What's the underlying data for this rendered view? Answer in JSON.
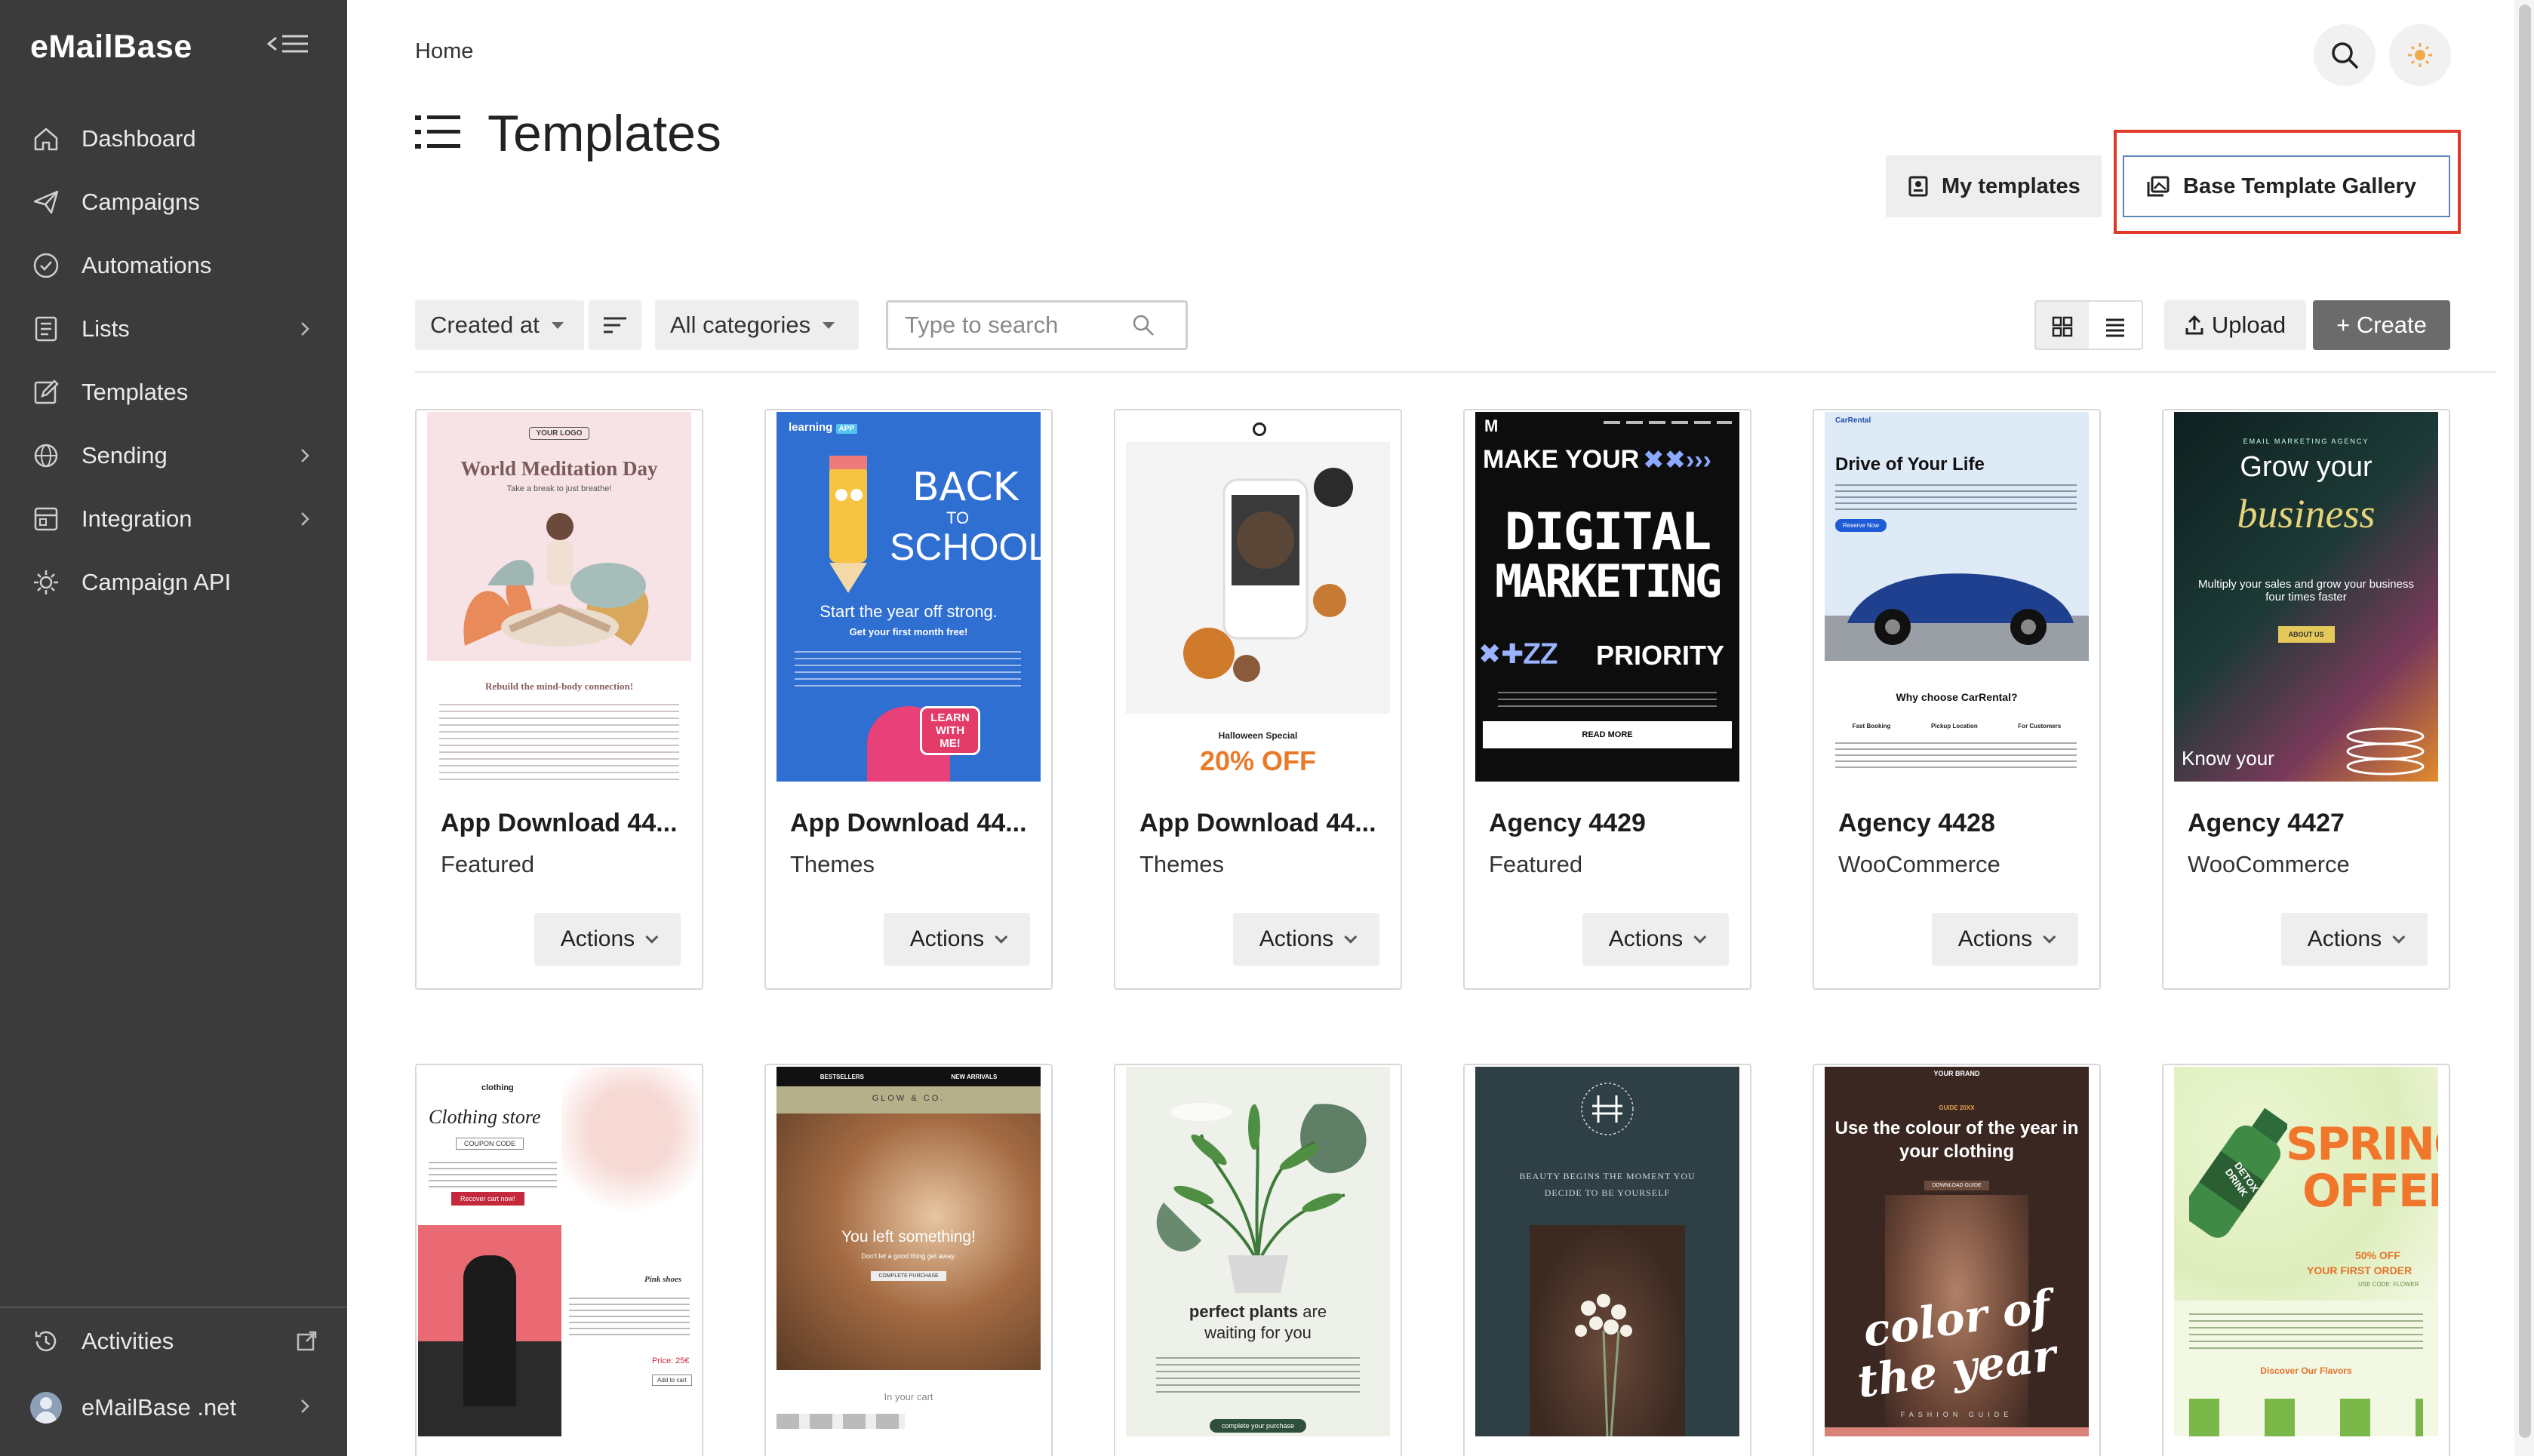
{
  "app": {
    "brand": "eMailBase"
  },
  "sidebar": {
    "items": [
      {
        "label": "Dashboard",
        "icon": "home-icon"
      },
      {
        "label": "Campaigns",
        "icon": "paper-plane-icon"
      },
      {
        "label": "Automations",
        "icon": "shield-check-icon"
      },
      {
        "label": "Lists",
        "icon": "list-icon"
      },
      {
        "label": "Templates",
        "icon": "edit-icon"
      },
      {
        "label": "Sending",
        "icon": "globe-icon"
      },
      {
        "label": "Integration",
        "icon": "integration-icon"
      },
      {
        "label": "Campaign API",
        "icon": "api-gear-icon"
      }
    ],
    "bottom": {
      "activities": "Activities",
      "account": "eMailBase .net"
    }
  },
  "header": {
    "breadcrumb": "Home",
    "title": "Templates"
  },
  "tabs": {
    "my_templates": "My templates",
    "gallery": "Base Template Gallery"
  },
  "toolbar": {
    "sort_by": "Created at",
    "category": "All categories",
    "search_placeholder": "Type to search",
    "upload": "Upload",
    "create": "+ Create"
  },
  "actions_label": "Actions",
  "templates": [
    {
      "title": "App Download 44...",
      "category": "Featured",
      "thumb": {
        "logo": "YOUR LOGO",
        "heading": "World Meditation Day",
        "sub": "Take a break to just breathe!",
        "body": "Rebuild the mind-body connection!"
      }
    },
    {
      "title": "App Download 44...",
      "category": "Themes",
      "thumb": {
        "brand": "learning",
        "brand_tag": "APP",
        "line1": "BACK",
        "line2": "TO",
        "line3": "SCHOOL",
        "tagline": "Start the year off strong.",
        "sub": "Get your first month free!",
        "badge": "LEARN WITH ME!"
      }
    },
    {
      "title": "App Download 44...",
      "category": "Themes",
      "thumb": {
        "kicker": "Halloween Special",
        "offer": "20% OFF"
      }
    },
    {
      "title": "Agency 4429",
      "category": "Featured",
      "thumb": {
        "logo": "M",
        "line1": "MAKE YOUR",
        "line2": "DIGITAL",
        "line3": "MARKETING",
        "line4": "PRIORITY",
        "cta": "READ MORE"
      }
    },
    {
      "title": "Agency 4428",
      "category": "WooCommerce",
      "thumb": {
        "brand": "CarRental",
        "heading": "Drive of Your Life",
        "cta": "Reserve Now",
        "sub": "Why choose CarRental?",
        "f1": "Fast Booking",
        "f2": "Pickup Location",
        "f3": "For Customers"
      }
    },
    {
      "title": "Agency 4427",
      "category": "WooCommerce",
      "thumb": {
        "kicker": "EMAIL MARKETING AGENCY",
        "line1": "Grow your",
        "line2": "business",
        "sub": "Multiply your sales and grow your business four times faster",
        "cta": "ABOUT US",
        "footer": "Know your"
      }
    },
    {
      "title": "",
      "category": "",
      "thumb": {
        "brand": "clothing",
        "heading": "Clothing store",
        "code": "COUPON CODE",
        "cta": "Recover cart now!",
        "item": "Pink shoes",
        "price": "Price: 25€",
        "cta2": "Add to cart"
      }
    },
    {
      "title": "",
      "category": "",
      "thumb": {
        "nav1": "BESTSELLERS",
        "nav2": "NEW ARRIVALS",
        "brand": "GLOW & CO.",
        "heading": "You left something!",
        "sub": "Don't let a good thing get away.",
        "cta": "COMPLETE PURCHASE",
        "footer": "In your cart"
      }
    },
    {
      "title": "",
      "category": "",
      "thumb": {
        "heading_b": "perfect plants",
        "heading_r": "are",
        "heading2": "waiting for you",
        "cta": "complete your purchase"
      }
    },
    {
      "title": "",
      "category": "",
      "thumb": {
        "line1": "BEAUTY BEGINS THE MOMENT YOU",
        "line2": "DECIDE TO BE YOURSELF"
      }
    },
    {
      "title": "",
      "category": "",
      "thumb": {
        "brand": "YOUR BRAND",
        "kicker": "GUIDE 20XX",
        "heading": "Use the colour of the year in your clothing",
        "cta": "DOWNLOAD GUIDE",
        "script1": "color of",
        "script2": "the year",
        "footer": "FASHION GUIDE"
      }
    },
    {
      "title": "",
      "category": "",
      "thumb": {
        "line1": "SPRING",
        "line2": "OFFER",
        "bottle": "DETOX DRINK",
        "deal": "50% OFF",
        "deal2": "YOUR FIRST ORDER",
        "code": "USE CODE: FLOWER",
        "cta": "Discover Our Flavors"
      }
    }
  ],
  "colors": {
    "sidebar_bg": "#3b3b3b",
    "create_bg": "#6b6b6b",
    "highlight": "#e0392a",
    "gallery_border": "#5b86b5"
  }
}
